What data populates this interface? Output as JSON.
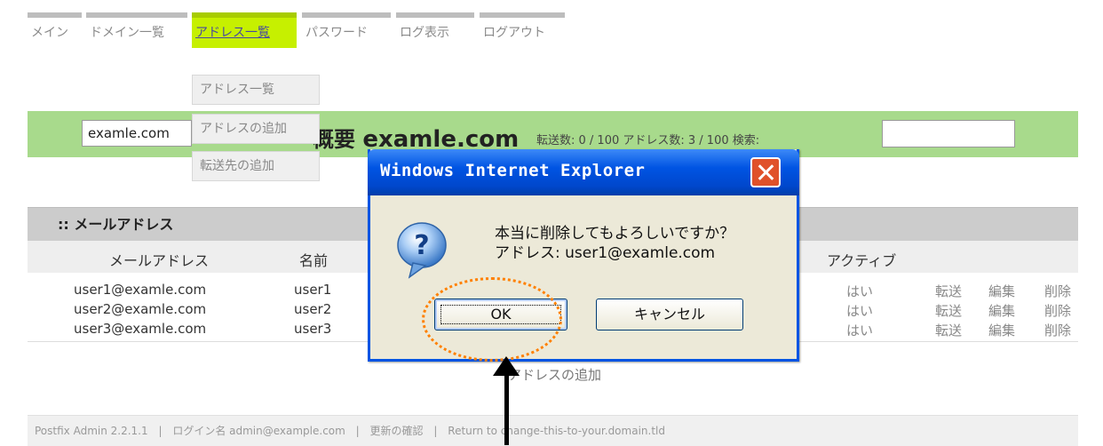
{
  "nav": {
    "items": [
      {
        "label": "メイン"
      },
      {
        "label": "ドメイン一覧"
      },
      {
        "label": "アドレス一覧"
      },
      {
        "label": "パスワード"
      },
      {
        "label": "ログ表示"
      },
      {
        "label": "ログアウト"
      }
    ],
    "active_index": 2,
    "submenu": [
      "アドレス一覧",
      "アドレスの追加",
      "転送先の追加"
    ]
  },
  "bar": {
    "domain_value": "examle.com",
    "overview_label": "概要",
    "domain_name": "examle.com",
    "stats": "転送数: 0 / 100   アドレス数: 3 / 100   検索:",
    "search_value": ""
  },
  "table": {
    "section_title": ":: メールアドレス",
    "columns": [
      "メールアドレス",
      "名前",
      "アクティブ"
    ],
    "rows": [
      {
        "email": "user1@examle.com",
        "name": "user1",
        "active": "はい",
        "forward": "転送",
        "edit": "編集",
        "delete": "削除"
      },
      {
        "email": "user2@examle.com",
        "name": "user2",
        "active": "はい",
        "forward": "転送",
        "edit": "編集",
        "delete": "削除"
      },
      {
        "email": "user3@examle.com",
        "name": "user3",
        "active": "はい",
        "forward": "転送",
        "edit": "編集",
        "delete": "削除"
      }
    ]
  },
  "add_address_label": "アドレスの追加",
  "footer": {
    "version": "Postfix Admin 2.2.1.1",
    "login": "ログイン名 admin@example.com",
    "update": "更新の確認",
    "return_link": "Return to change-this-to-your.domain.tld"
  },
  "dialog": {
    "title": "Windows Internet Explorer",
    "message_line1": "本当に削除してもよろしいですか？",
    "message_line2": "アドレス: user1@examle.com",
    "ok_label": "OK",
    "cancel_label": "キャンセル",
    "icon": "question-icon"
  },
  "colors": {
    "nav_active": "#c6f000",
    "green_bar": "#a8da8c",
    "annotation_circle": "#ff8000",
    "xp_title_blue": "#0054e3"
  }
}
